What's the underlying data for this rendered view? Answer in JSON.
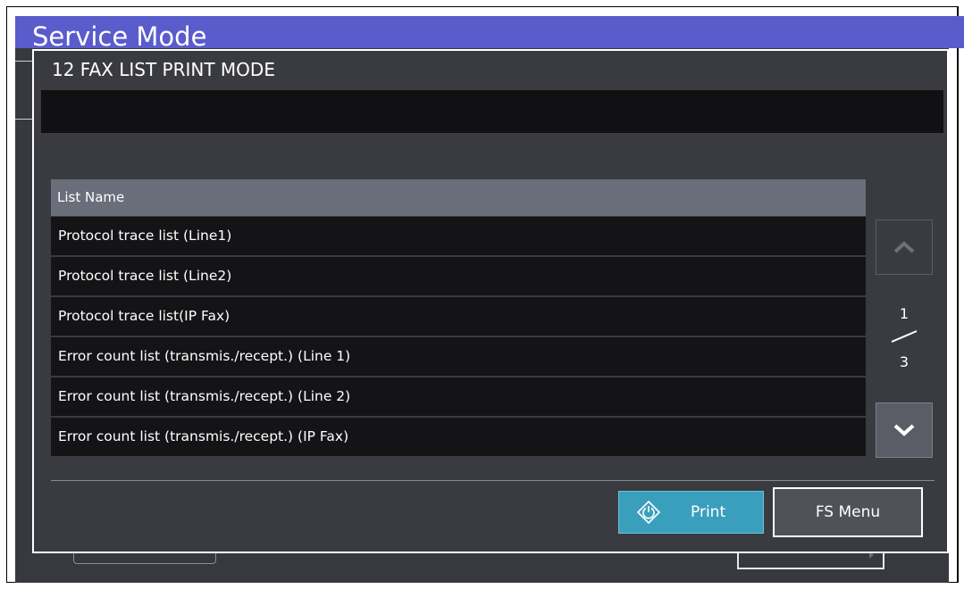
{
  "background": {
    "header_title": "Service Mode",
    "header_color": "#5a5ccc"
  },
  "dialog": {
    "title": "12 FAX LIST PRINT MODE",
    "message": ""
  },
  "table": {
    "header": "List Name",
    "rows": [
      "Protocol trace list (Line1)",
      "Protocol trace list (Line2)",
      "Protocol trace list(IP Fax)",
      "Error count list (transmis./recept.) (Line 1)",
      "Error count list (transmis./recept.) (Line 2)",
      "Error count list (transmis./recept.) (IP Fax)"
    ]
  },
  "pager": {
    "current": "1",
    "total": "3",
    "up_icon": "chevron-up-icon",
    "down_icon": "chevron-down-icon"
  },
  "buttons": {
    "print_label": "Print",
    "print_icon": "start-diamond-icon",
    "print_color": "#3a9fbd",
    "fs_menu_label": "FS Menu"
  }
}
